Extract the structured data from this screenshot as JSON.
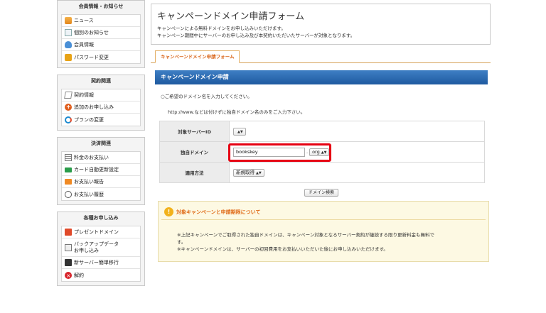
{
  "sidebar": {
    "sections": [
      {
        "title": "会員情報・お知らせ",
        "items": [
          {
            "label": "ニュース",
            "icon": "news-icon"
          },
          {
            "label": "個別のお知らせ",
            "icon": "document-icon"
          },
          {
            "label": "会員情報",
            "icon": "user-icon"
          },
          {
            "label": "パスワード変更",
            "icon": "lock-icon"
          }
        ]
      },
      {
        "title": "契約関連",
        "items": [
          {
            "label": "契約情報",
            "icon": "contract-icon"
          },
          {
            "label": "追加のお申し込み",
            "icon": "add-icon"
          },
          {
            "label": "プランの変更",
            "icon": "swap-icon"
          }
        ]
      },
      {
        "title": "決済関連",
        "items": [
          {
            "label": "料金のお支払い",
            "icon": "invoice-icon"
          },
          {
            "label": "カード自動更新設定",
            "icon": "card-icon"
          },
          {
            "label": "お支払い報告",
            "icon": "report-icon"
          },
          {
            "label": "お支払い履歴",
            "icon": "clock-icon"
          }
        ]
      },
      {
        "title": "各種お申し込み",
        "items": [
          {
            "label": "プレゼントドメイン",
            "icon": "gift-icon"
          },
          {
            "label": "バックアップデータ",
            "label2": "お申し込み",
            "icon": "backup-icon"
          },
          {
            "label": "新サーバー簡単移行",
            "icon": "server-icon"
          },
          {
            "label": "解約",
            "icon": "cancel-icon"
          }
        ]
      }
    ]
  },
  "page": {
    "title": "キャンペーンドメイン申請フォーム",
    "desc1": "キャンペーンによる無料ドメインをお申し込みいただけます。",
    "desc2": "キャンペーン期間中にサーバーのお申し込み及び本契約いただいたサーバーが対象となります。",
    "tab": "キャンペーンドメイン申請フォーム",
    "section_title": "キャンペーンドメイン申請",
    "instruction": "○ご希望のドメイン名を入力してください。",
    "instruction2": "http://www.などは付けずに独自ドメイン名のみをご入力下さい。"
  },
  "form": {
    "server_label": "対象サーバーID",
    "server_value": "",
    "domain_label": "独自ドメイン",
    "domain_value": "bookskey",
    "domain_dot": ".",
    "tld_value": "org",
    "method_label": "適用方法",
    "method_value": "新規取得",
    "search_button": "ドメイン検索"
  },
  "notice": {
    "title": "対象キャンペーンと申請期限について",
    "line1": "※上記キャンペーンでご取得された独自ドメインは、キャンペーン対象となるサーバー契約が継続する限り更新料金も無料で",
    "line2": "す。",
    "line3": "※キャンペーンドメインは、サーバーの初回費用をお支払いいただいた後にお申し込みいただけます。"
  },
  "colors": {
    "accent_blue": "#1f5aa0",
    "highlight_red": "#e60012",
    "tab_orange": "#d9661b"
  }
}
